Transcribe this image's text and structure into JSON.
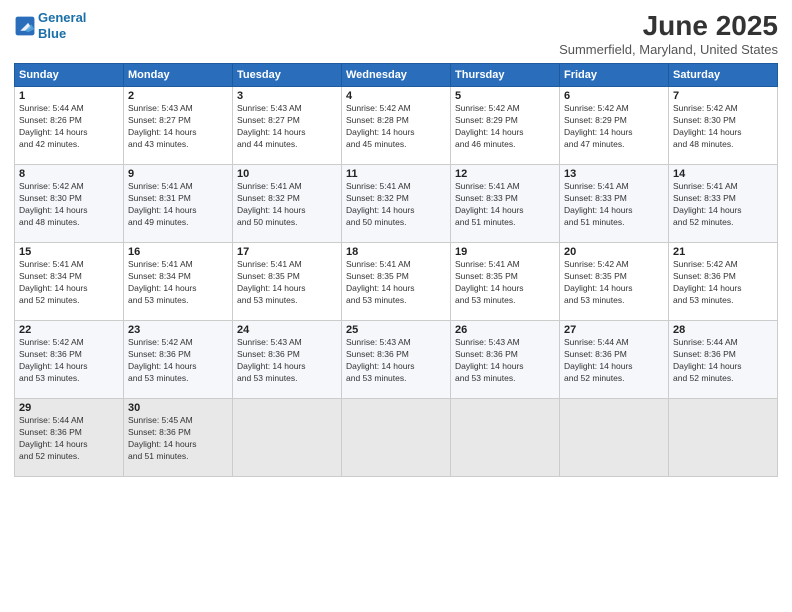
{
  "header": {
    "logo_line1": "General",
    "logo_line2": "Blue",
    "month": "June 2025",
    "location": "Summerfield, Maryland, United States"
  },
  "weekdays": [
    "Sunday",
    "Monday",
    "Tuesday",
    "Wednesday",
    "Thursday",
    "Friday",
    "Saturday"
  ],
  "weeks": [
    [
      {
        "day": "1",
        "info": "Sunrise: 5:44 AM\nSunset: 8:26 PM\nDaylight: 14 hours\nand 42 minutes."
      },
      {
        "day": "2",
        "info": "Sunrise: 5:43 AM\nSunset: 8:27 PM\nDaylight: 14 hours\nand 43 minutes."
      },
      {
        "day": "3",
        "info": "Sunrise: 5:43 AM\nSunset: 8:27 PM\nDaylight: 14 hours\nand 44 minutes."
      },
      {
        "day": "4",
        "info": "Sunrise: 5:42 AM\nSunset: 8:28 PM\nDaylight: 14 hours\nand 45 minutes."
      },
      {
        "day": "5",
        "info": "Sunrise: 5:42 AM\nSunset: 8:29 PM\nDaylight: 14 hours\nand 46 minutes."
      },
      {
        "day": "6",
        "info": "Sunrise: 5:42 AM\nSunset: 8:29 PM\nDaylight: 14 hours\nand 47 minutes."
      },
      {
        "day": "7",
        "info": "Sunrise: 5:42 AM\nSunset: 8:30 PM\nDaylight: 14 hours\nand 48 minutes."
      }
    ],
    [
      {
        "day": "8",
        "info": "Sunrise: 5:42 AM\nSunset: 8:30 PM\nDaylight: 14 hours\nand 48 minutes."
      },
      {
        "day": "9",
        "info": "Sunrise: 5:41 AM\nSunset: 8:31 PM\nDaylight: 14 hours\nand 49 minutes."
      },
      {
        "day": "10",
        "info": "Sunrise: 5:41 AM\nSunset: 8:32 PM\nDaylight: 14 hours\nand 50 minutes."
      },
      {
        "day": "11",
        "info": "Sunrise: 5:41 AM\nSunset: 8:32 PM\nDaylight: 14 hours\nand 50 minutes."
      },
      {
        "day": "12",
        "info": "Sunrise: 5:41 AM\nSunset: 8:33 PM\nDaylight: 14 hours\nand 51 minutes."
      },
      {
        "day": "13",
        "info": "Sunrise: 5:41 AM\nSunset: 8:33 PM\nDaylight: 14 hours\nand 51 minutes."
      },
      {
        "day": "14",
        "info": "Sunrise: 5:41 AM\nSunset: 8:33 PM\nDaylight: 14 hours\nand 52 minutes."
      }
    ],
    [
      {
        "day": "15",
        "info": "Sunrise: 5:41 AM\nSunset: 8:34 PM\nDaylight: 14 hours\nand 52 minutes."
      },
      {
        "day": "16",
        "info": "Sunrise: 5:41 AM\nSunset: 8:34 PM\nDaylight: 14 hours\nand 53 minutes."
      },
      {
        "day": "17",
        "info": "Sunrise: 5:41 AM\nSunset: 8:35 PM\nDaylight: 14 hours\nand 53 minutes."
      },
      {
        "day": "18",
        "info": "Sunrise: 5:41 AM\nSunset: 8:35 PM\nDaylight: 14 hours\nand 53 minutes."
      },
      {
        "day": "19",
        "info": "Sunrise: 5:41 AM\nSunset: 8:35 PM\nDaylight: 14 hours\nand 53 minutes."
      },
      {
        "day": "20",
        "info": "Sunrise: 5:42 AM\nSunset: 8:35 PM\nDaylight: 14 hours\nand 53 minutes."
      },
      {
        "day": "21",
        "info": "Sunrise: 5:42 AM\nSunset: 8:36 PM\nDaylight: 14 hours\nand 53 minutes."
      }
    ],
    [
      {
        "day": "22",
        "info": "Sunrise: 5:42 AM\nSunset: 8:36 PM\nDaylight: 14 hours\nand 53 minutes."
      },
      {
        "day": "23",
        "info": "Sunrise: 5:42 AM\nSunset: 8:36 PM\nDaylight: 14 hours\nand 53 minutes."
      },
      {
        "day": "24",
        "info": "Sunrise: 5:43 AM\nSunset: 8:36 PM\nDaylight: 14 hours\nand 53 minutes."
      },
      {
        "day": "25",
        "info": "Sunrise: 5:43 AM\nSunset: 8:36 PM\nDaylight: 14 hours\nand 53 minutes."
      },
      {
        "day": "26",
        "info": "Sunrise: 5:43 AM\nSunset: 8:36 PM\nDaylight: 14 hours\nand 53 minutes."
      },
      {
        "day": "27",
        "info": "Sunrise: 5:44 AM\nSunset: 8:36 PM\nDaylight: 14 hours\nand 52 minutes."
      },
      {
        "day": "28",
        "info": "Sunrise: 5:44 AM\nSunset: 8:36 PM\nDaylight: 14 hours\nand 52 minutes."
      }
    ],
    [
      {
        "day": "29",
        "info": "Sunrise: 5:44 AM\nSunset: 8:36 PM\nDaylight: 14 hours\nand 52 minutes."
      },
      {
        "day": "30",
        "info": "Sunrise: 5:45 AM\nSunset: 8:36 PM\nDaylight: 14 hours\nand 51 minutes."
      },
      {
        "day": "",
        "info": ""
      },
      {
        "day": "",
        "info": ""
      },
      {
        "day": "",
        "info": ""
      },
      {
        "day": "",
        "info": ""
      },
      {
        "day": "",
        "info": ""
      }
    ]
  ]
}
